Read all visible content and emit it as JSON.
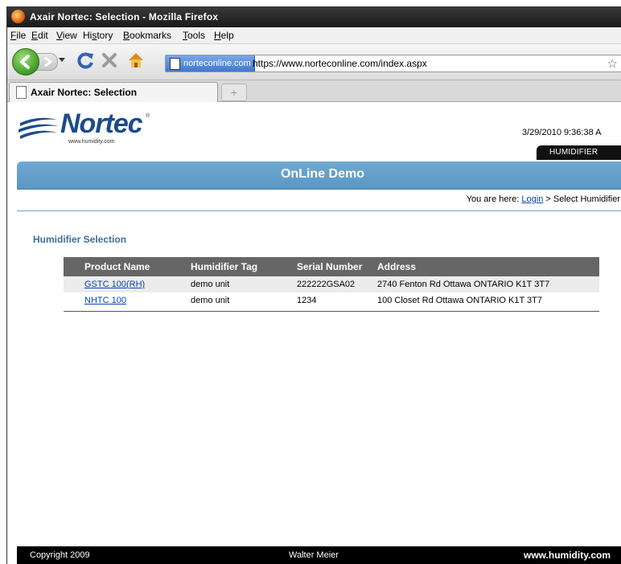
{
  "window": {
    "title": "Axair Nortec: Selection - Mozilla Firefox"
  },
  "menu": [
    {
      "label": "File",
      "accel": "F",
      "rest": "ile"
    },
    {
      "label": "Edit",
      "accel": "E",
      "rest": "dit"
    },
    {
      "label": "View",
      "accel": "V",
      "rest": "iew"
    },
    {
      "label": "History",
      "pre": "Hi",
      "accel": "s",
      "rest": "tory"
    },
    {
      "label": "Bookmarks",
      "accel": "B",
      "rest": "ookmarks"
    },
    {
      "label": "Tools",
      "accel": "T",
      "rest": "ools"
    },
    {
      "label": "Help",
      "accel": "H",
      "rest": "elp"
    }
  ],
  "navbar": {
    "site_identity": "norteconline.com",
    "url": "https://www.norteconline.com/index.aspx"
  },
  "tabs": [
    {
      "label": "Axair Nortec: Selection"
    }
  ],
  "header": {
    "logo_text": "Nortec",
    "logo_reg": "®",
    "logo_site": "www.humidity.com",
    "datetime": "3/29/2010 9:36:38 A",
    "listings_tab": "HUMIDIFIER LISTINGS"
  },
  "banner": {
    "title": "OnLine Demo"
  },
  "breadcrumb": {
    "prefix": "You are here: ",
    "link": "Login",
    "sep": " > ",
    "current": "Select Humidifier"
  },
  "section_title": "Humidifier Selection",
  "table": {
    "columns": [
      "Product Name",
      "Humidifier Tag",
      "Serial Number",
      "Address"
    ],
    "rows": [
      {
        "product": "GSTC 100(RH)",
        "tag": "demo unit",
        "serial": "222222GSA02",
        "address": "2740 Fenton Rd Ottawa ONTARIO K1T 3T7"
      },
      {
        "product": "NHTC 100",
        "tag": "demo unit",
        "serial": "1234",
        "address": "100 Closet Rd Ottawa ONTARIO K1T 3T7"
      }
    ]
  },
  "footer": {
    "copyright": "Copyright 2009",
    "company": "Walter Meier",
    "site": "www.humidity.com"
  },
  "colors": {
    "banner": "#6fa9d2",
    "section_title": "#3b6e9e",
    "link": "#0645ad",
    "table_header": "#666666"
  }
}
